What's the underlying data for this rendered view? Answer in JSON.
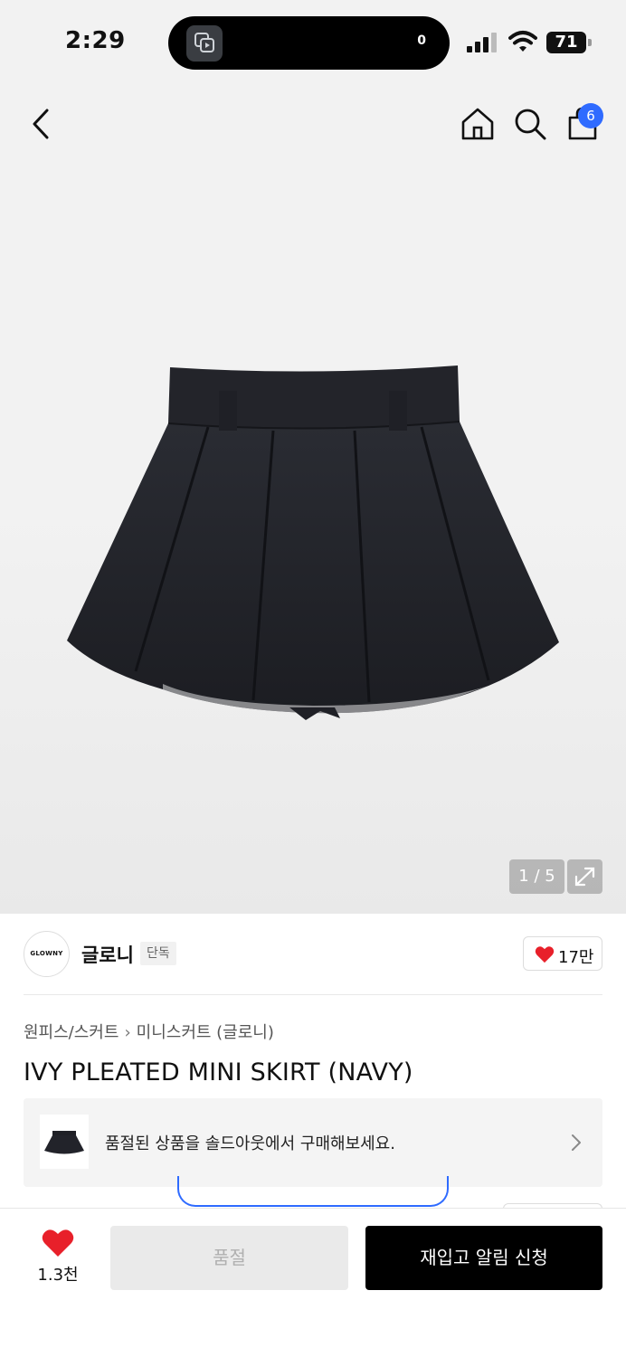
{
  "status_bar": {
    "time": "2:29",
    "island_count": "0",
    "battery": "71"
  },
  "nav": {
    "cart_badge": "6"
  },
  "gallery": {
    "counter": "1 / 5"
  },
  "brand": {
    "logo_text": "GLOWNY",
    "name": "글로니",
    "tag": "단독",
    "like_count": "17만",
    "heart_color": "#e8202a"
  },
  "product": {
    "breadcrumb": [
      "원피스/스커트",
      "미니스커트 (글로니)"
    ],
    "title": "IVY PLEATED MINI SKIRT (NAVY)"
  },
  "soldout_banner": {
    "text": "품절된 상품을 솔드아웃에서 구매해보세요."
  },
  "bottom_bar": {
    "wish_count": "1.3천",
    "soldout_label": "품절",
    "restock_label": "재입고 알림 신청"
  },
  "colors": {
    "accent": "#2f6bff",
    "primary_button": "#000000",
    "disabled_button": "#eaeaea"
  }
}
